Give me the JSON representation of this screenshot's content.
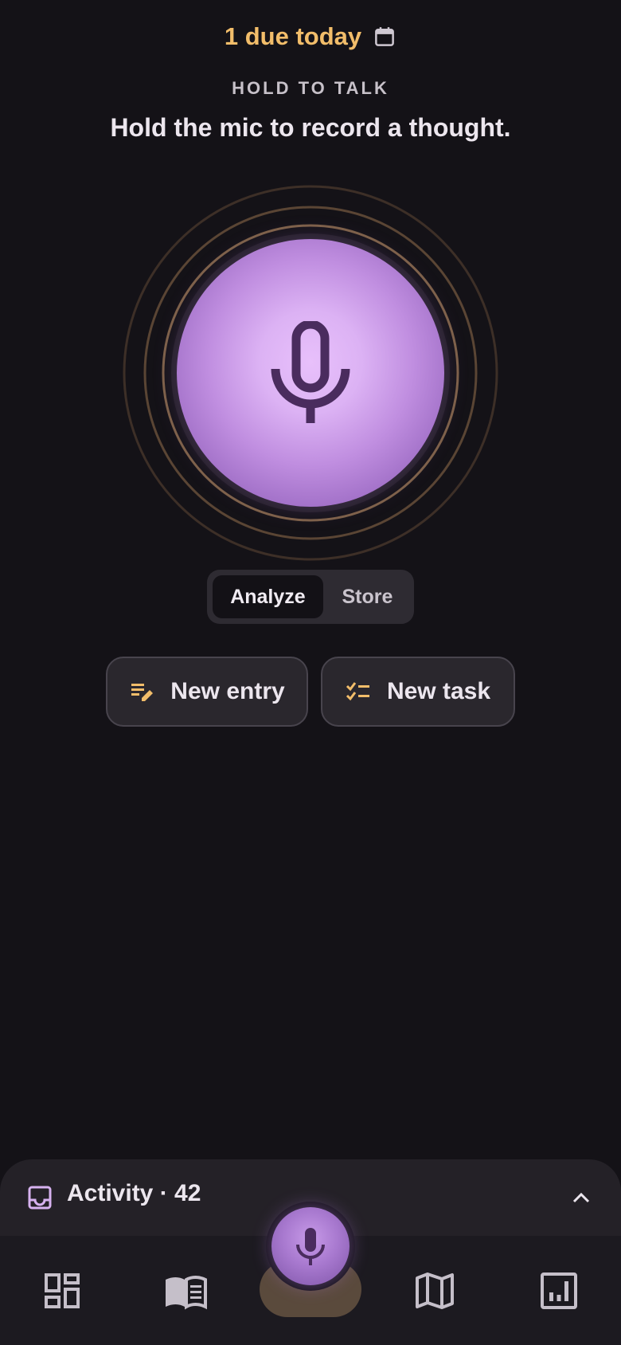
{
  "header": {
    "due_text": "1 due today",
    "eyebrow": "HOLD TO TALK",
    "headline": "Hold the mic to record a thought."
  },
  "mode_toggle": {
    "options": [
      "Analyze",
      "Store"
    ],
    "selected": "Analyze"
  },
  "actions": {
    "new_entry": "New entry",
    "new_task": "New task"
  },
  "activity": {
    "label": "Activity · 42"
  },
  "icons": {
    "due": "calendar-icon",
    "record": "mic-icon",
    "new_entry": "edit-note-icon",
    "new_task": "checklist-icon",
    "activity": "inbox-icon",
    "expand": "chevron-up-icon",
    "nav": [
      "dashboard-icon",
      "book-icon",
      "mic-icon",
      "map-icon",
      "analytics-icon"
    ]
  },
  "colors": {
    "background": "#141217",
    "accent_gold": "#f2bd6a",
    "accent_purple": "#dcb2f4",
    "icon_dark": "#4a2c5e",
    "nav_active_pill": "#5a4a3c"
  }
}
